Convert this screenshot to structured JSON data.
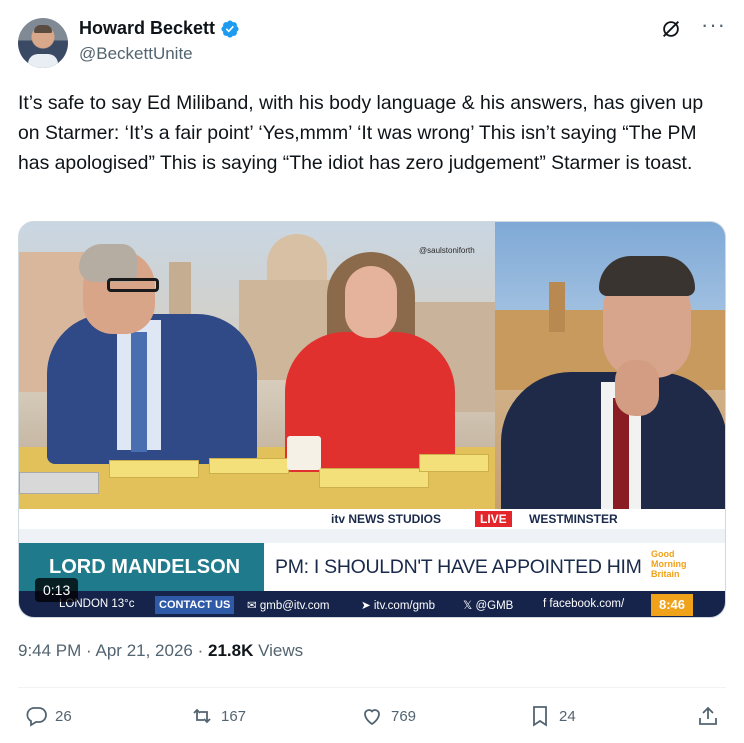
{
  "author": {
    "name": "Howard Beckett",
    "handle": "@BeckettUnite",
    "verified_color": "#1d9bf0"
  },
  "tweet": {
    "text": "It’s safe to say Ed Miliband, with his body language & his answers, has given up on Starmer: ‘It’s a fair point’ ‘Yes,mmm’ ‘It was wrong’ This isn’t saying “The PM has apologised” This is saying “The idiot has zero judgement” Starmer is toast."
  },
  "media": {
    "video_time": "0:13",
    "watermark": "@saulstoniforth",
    "broadcast": {
      "top_bar": {
        "studio": "itv NEWS STUDIOS",
        "live": "LIVE",
        "location": "WESTMINSTER"
      },
      "lower_third": {
        "name": "LORD MANDELSON",
        "headline": "PM: I SHOULDN'T HAVE APPOINTED HIM",
        "brand": "Good Morning Britain"
      },
      "ticker": {
        "weather": "LONDON 13°c",
        "contact": "CONTACT US",
        "email": "gmb@itv.com",
        "web": "itv.com/gmb",
        "x_handle": "@GMB",
        "facebook": "facebook.com/",
        "clock": "8:46"
      }
    }
  },
  "meta": {
    "time": "9:44 PM",
    "sep1": "·",
    "date": "Apr 21, 2026",
    "sep2": "·",
    "views_count": "21.8K",
    "views_label": "Views"
  },
  "actions": {
    "replies": "26",
    "reposts": "167",
    "likes": "769",
    "bookmarks": "24"
  },
  "icons": {
    "reply": "reply-icon",
    "repost": "repost-icon",
    "like": "heart-icon",
    "bookmark": "bookmark-icon",
    "share": "share-icon",
    "grok": "grok-icon",
    "more": "more-icon"
  }
}
